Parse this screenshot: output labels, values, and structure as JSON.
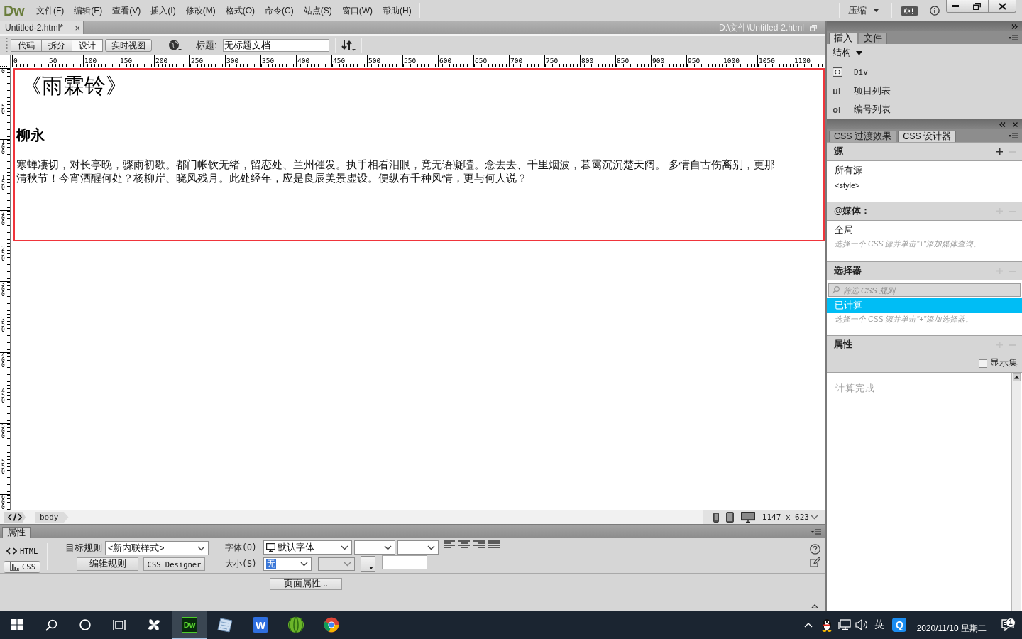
{
  "menu_bar": {
    "logo": "Dw",
    "menus": [
      "文件(F)",
      "编辑(E)",
      "查看(V)",
      "插入(I)",
      "修改(M)",
      "格式(O)",
      "命令(C)",
      "站点(S)",
      "窗口(W)",
      "帮助(H)"
    ],
    "workspace": "压缩"
  },
  "document_tab": {
    "title": "Untitled-2.html*",
    "close": "×",
    "path": "D:\\文件\\Untitled-2.html"
  },
  "toolbar": {
    "views": [
      {
        "label": "代码",
        "selected": false
      },
      {
        "label": "拆分",
        "selected": false
      },
      {
        "label": "设计",
        "selected": true
      },
      {
        "label": "实时视图",
        "selected": false
      }
    ],
    "title_label": "标题:",
    "title_value": "无标题文档"
  },
  "rulers": {
    "horizontal": [
      "0",
      "50",
      "100",
      "150",
      "200",
      "250",
      "300",
      "350",
      "400",
      "450",
      "500",
      "550",
      "600",
      "650",
      "700",
      "750",
      "800",
      "850",
      "900",
      "950",
      "1000",
      "1050",
      "1100"
    ],
    "vertical": [
      "0",
      "50",
      "100",
      "150",
      "200",
      "250",
      "300",
      "350",
      "400",
      "450",
      "500",
      "550",
      "600"
    ]
  },
  "document": {
    "heading": "《雨霖铃》",
    "author": "柳永",
    "paragraph_lines": [
      "寒蝉凄切，对长亭晚，骤雨初歇。都门帐饮无绪，留恋处、兰州催发。执手相看泪眼，竟无语凝噎。念去去、千里烟波，暮霭沉沉楚天阔。 多情自古伤离别，更那",
      "清秋节！今宵酒醒何处？杨柳岸、晓风残月。此处经年，应是良辰美景虚设。便纵有千种风情，更与何人说？"
    ]
  },
  "status_bar": {
    "tags": [
      "body"
    ],
    "window_size": "1147 x 623"
  },
  "properties": {
    "title": "属性",
    "modes": [
      {
        "kind": "html",
        "label": "HTML",
        "selected": false
      },
      {
        "kind": "css",
        "label": "CSS",
        "selected": true
      }
    ],
    "target_rule_label": "目标规则",
    "target_rule": "<新内联样式>",
    "rule_buttons": [
      "编辑规则",
      "CSS Designer"
    ],
    "font_label": "字体(O)",
    "font": "默认字体",
    "size_label": "大小(S)",
    "size": "无",
    "page_properties": "页面属性..."
  },
  "insert_panel": {
    "tabs": [
      {
        "label": "插入",
        "selected": true
      },
      {
        "label": "文件",
        "selected": false
      }
    ],
    "category": "结构",
    "items": [
      {
        "kind": "icon",
        "label": "Div"
      },
      {
        "kind": "tag",
        "tag": "ul",
        "label": "项目列表"
      },
      {
        "kind": "tag",
        "tag": "ol",
        "label": "编号列表"
      }
    ]
  },
  "css_designer": {
    "tabs": [
      {
        "label": "CSS 过渡效果",
        "selected": false
      },
      {
        "label": "CSS 设计器",
        "selected": true
      }
    ],
    "sections": [
      {
        "kind": "list",
        "title": "源",
        "add_enabled": true,
        "remove_enabled": false,
        "items": [
          {
            "kind": "text",
            "label": "所有源",
            "selected": false
          },
          {
            "kind": "code",
            "label": "<style>",
            "selected": false
          }
        ]
      },
      {
        "kind": "list",
        "title": "@媒体：",
        "add_enabled": false,
        "remove_enabled": false,
        "items": [
          {
            "kind": "text",
            "label": "全局",
            "selected": false
          }
        ],
        "hint": "选择一个 CSS 源并单击\"+\"添加媒体查询。"
      },
      {
        "kind": "filter_list",
        "title": "选择器",
        "add_enabled": false,
        "remove_enabled": false,
        "filter_placeholder": "筛选 CSS 规则",
        "items": [
          {
            "kind": "text",
            "label": "已计算",
            "selected": true
          }
        ],
        "hint": "选择一个 CSS 源并单击\"+\"添加选择器。"
      },
      {
        "kind": "properties",
        "title": "属性",
        "add_enabled": false,
        "remove_enabled": false,
        "show_set": {
          "label": "显示集",
          "checked": false
        },
        "status": "计算完成"
      }
    ]
  },
  "taskbar": {
    "system": [
      {
        "kind": "start"
      },
      {
        "kind": "search"
      },
      {
        "kind": "cortana"
      },
      {
        "kind": "task_view"
      }
    ],
    "apps": [
      {
        "kind": "pinwheel",
        "active": false
      },
      {
        "kind": "dreamweaver",
        "label": "Dw",
        "active": true
      },
      {
        "kind": "notepad",
        "active": false
      },
      {
        "kind": "writer",
        "label": "W",
        "active": false
      },
      {
        "kind": "melon",
        "active": false
      },
      {
        "kind": "chrome",
        "active": false
      }
    ],
    "tray": [
      {
        "kind": "chevron"
      },
      {
        "kind": "penguin"
      },
      {
        "kind": "network"
      },
      {
        "kind": "volume"
      },
      {
        "kind": "ime",
        "label": "英"
      },
      {
        "kind": "q_app",
        "label": "Q"
      }
    ],
    "date": "2020/11/10 星期二",
    "notification_count": "1"
  }
}
